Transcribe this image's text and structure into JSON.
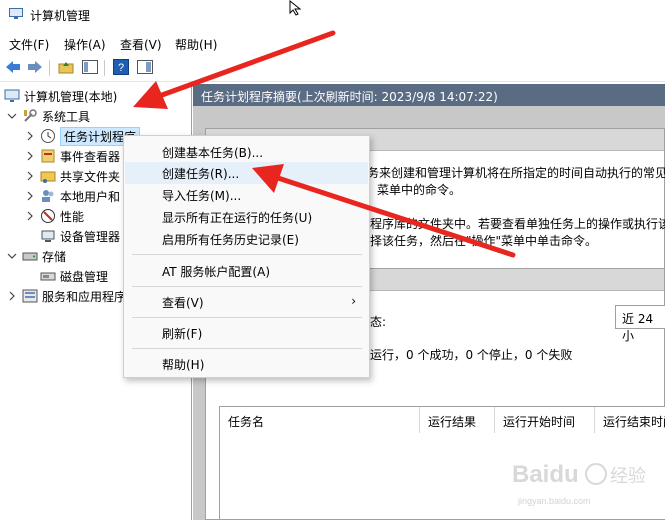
{
  "window": {
    "title": "计算机管理"
  },
  "menubar": {
    "items": [
      "文件(F)",
      "操作(A)",
      "查看(V)",
      "帮助(H)"
    ]
  },
  "tree": {
    "root": "计算机管理(本地)",
    "system_tools": "系统工具",
    "task_scheduler": "任务计划程序",
    "event_viewer": "事件查看器",
    "shared_folders": "共享文件夹",
    "local_users": "本地用户和",
    "performance": "性能",
    "device_manager": "设备管理器",
    "storage": "存储",
    "disk_mgmt": "磁盘管理",
    "services": "服务和应用程序"
  },
  "content": {
    "header": "任务计划程序摘要(上次刷新时间: 2023/9/8 14:07:22)",
    "desc": {
      "line1": "务来创建和管理计算机将在所指定的时间自动执行的常见",
      "line2": "菜单中的命令。",
      "line3": "程序库的文件夹中。若要查看单独任务上的操作或执行该",
      "line4": "择该任务，然后在\"操作\"菜单中单击命令。"
    },
    "status_label": "态:",
    "status_counts": "运行，0 个成功，0 个停止，0 个失败",
    "time_range": "近 24 小",
    "table_headers": [
      "任务名",
      "运行结果",
      "运行开始时间",
      "运行结束时间"
    ]
  },
  "context_menu": {
    "items": [
      "创建基本任务(B)...",
      "创建任务(R)...",
      "导入任务(M)...",
      "显示所有正在运行的任务(U)",
      "启用所有任务历史记录(E)",
      "AT 服务帐户配置(A)",
      "查看(V)",
      "刷新(F)",
      "帮助(H)"
    ],
    "submenu_arrow": "›"
  },
  "watermark": {
    "brand": "Baidu",
    "suffix": "经验",
    "url": "jingyan.baidu.com"
  },
  "colors": {
    "annotation_arrow": "#e8261f",
    "selection": "#cde8ff",
    "header_bar": "#5a6b84"
  }
}
